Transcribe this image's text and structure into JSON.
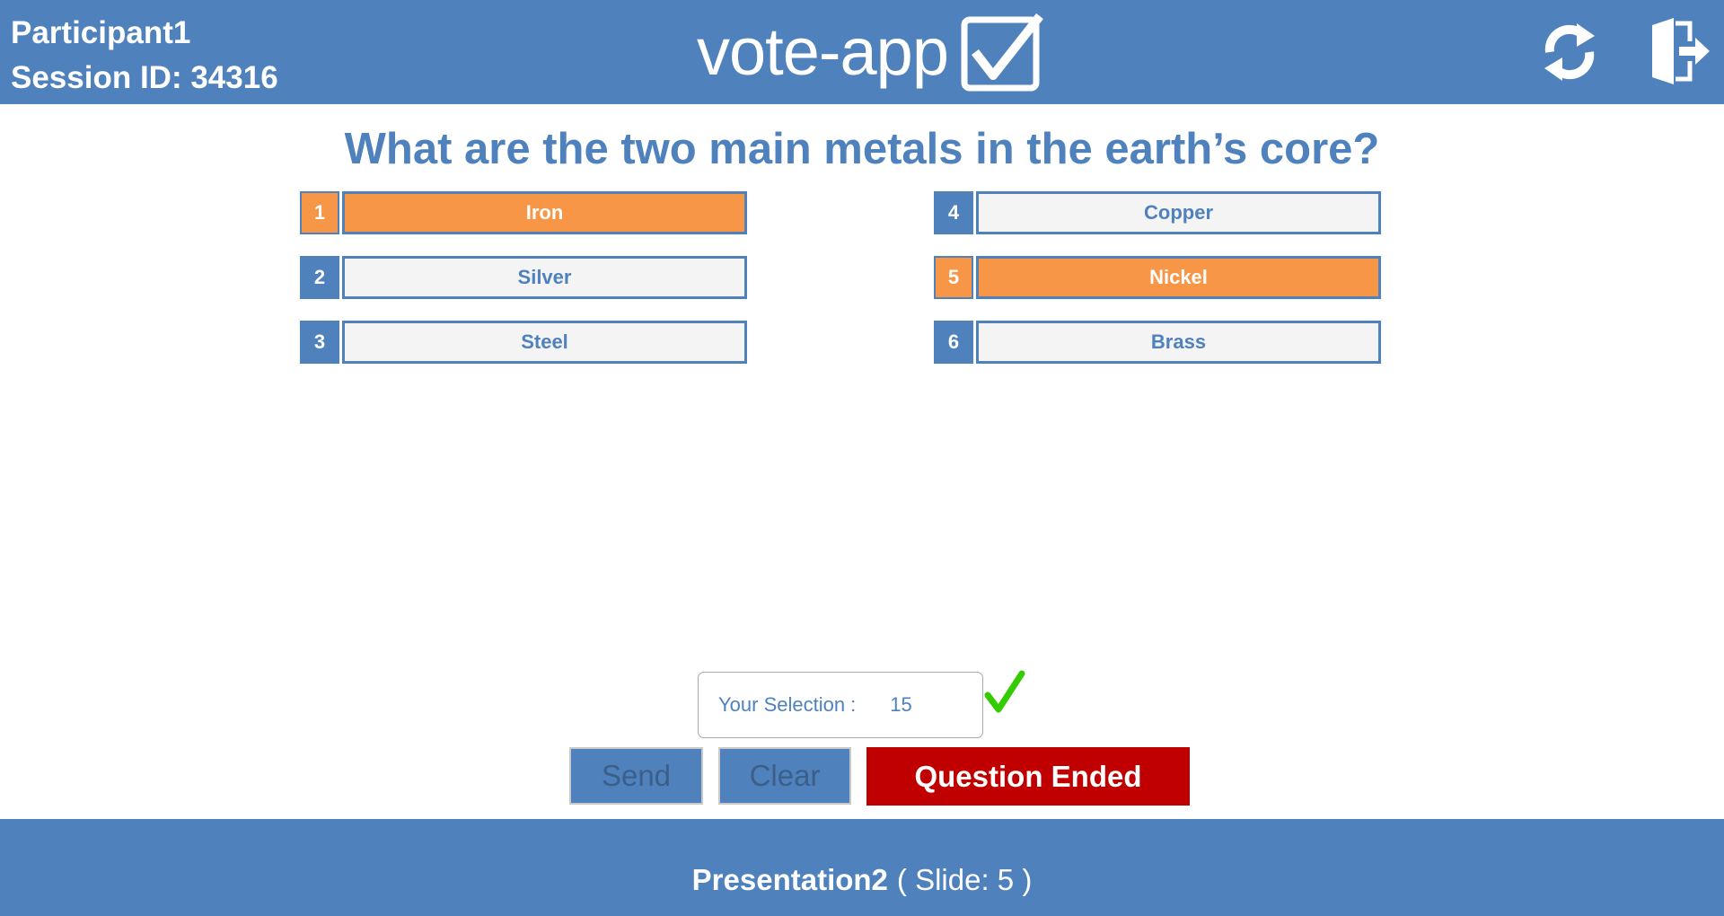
{
  "header": {
    "participant": "Participant1",
    "session_label": "Session ID: 34316",
    "logo_text": "vote-app",
    "refresh_icon": "refresh-icon",
    "exit_icon": "exit-icon"
  },
  "question": {
    "text": "What are the two main metals in the earth’s core?"
  },
  "options": [
    {
      "number": "1",
      "label": "Iron",
      "selected": true
    },
    {
      "number": "2",
      "label": "Silver",
      "selected": false
    },
    {
      "number": "3",
      "label": "Steel",
      "selected": false
    },
    {
      "number": "4",
      "label": "Copper",
      "selected": false
    },
    {
      "number": "5",
      "label": "Nickel",
      "selected": true
    },
    {
      "number": "6",
      "label": "Brass",
      "selected": false
    }
  ],
  "selection": {
    "label": "Your Selection :",
    "value": "15",
    "check_icon": "checkmark-icon"
  },
  "buttons": {
    "send": "Send",
    "clear": "Clear",
    "status": "Question Ended"
  },
  "footer": {
    "presentation": "Presentation2",
    "slide": "( Slide: 5 )"
  },
  "colors": {
    "primary": "#4f81bd",
    "selected": "#f79646",
    "ended": "#c00000",
    "check": "#33cc00"
  }
}
